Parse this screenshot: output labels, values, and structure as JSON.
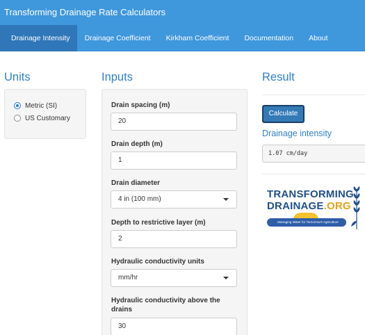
{
  "app": {
    "title": "Transforming Drainage Rate Calculators"
  },
  "nav": {
    "tabs": [
      {
        "label": "Drainage Intensity",
        "active": true
      },
      {
        "label": "Drainage Coefficient",
        "active": false
      },
      {
        "label": "Kirkham Coefficient",
        "active": false
      },
      {
        "label": "Documentation",
        "active": false
      },
      {
        "label": "About",
        "active": false
      }
    ]
  },
  "units": {
    "title": "Units",
    "options": [
      {
        "label": "Metric (SI)",
        "selected": true
      },
      {
        "label": "US Customary",
        "selected": false
      }
    ]
  },
  "inputs": {
    "title": "Inputs",
    "drain_spacing": {
      "label": "Drain spacing (m)",
      "value": "20"
    },
    "drain_depth": {
      "label": "Drain depth (m)",
      "value": "1"
    },
    "drain_diameter": {
      "label": "Drain diameter",
      "value": "4 in (100 mm)"
    },
    "restrictive_depth": {
      "label": "Depth to restrictive layer (m)",
      "value": "2"
    },
    "k_units": {
      "label": "Hydraulic conductivity units",
      "value": "mm/hr"
    },
    "k_above": {
      "label": "Hydraulic conductivity above the drains",
      "value": "30"
    }
  },
  "result": {
    "title": "Result",
    "calculate_label": "Calculate",
    "output_label": "Drainage intensity",
    "output_value": "1.07 cm/day"
  },
  "logo": {
    "line1": "TRANSFORMING",
    "line2_main": "DRAINAGE",
    "line2_suffix": ".ORG",
    "tagline": "Managing Water for Tomorrow's Agriculture"
  },
  "colors": {
    "navbar": "#3f97dc",
    "nav_active": "#2f77b8",
    "accent": "#2f80c8",
    "button": "#337ab7"
  }
}
